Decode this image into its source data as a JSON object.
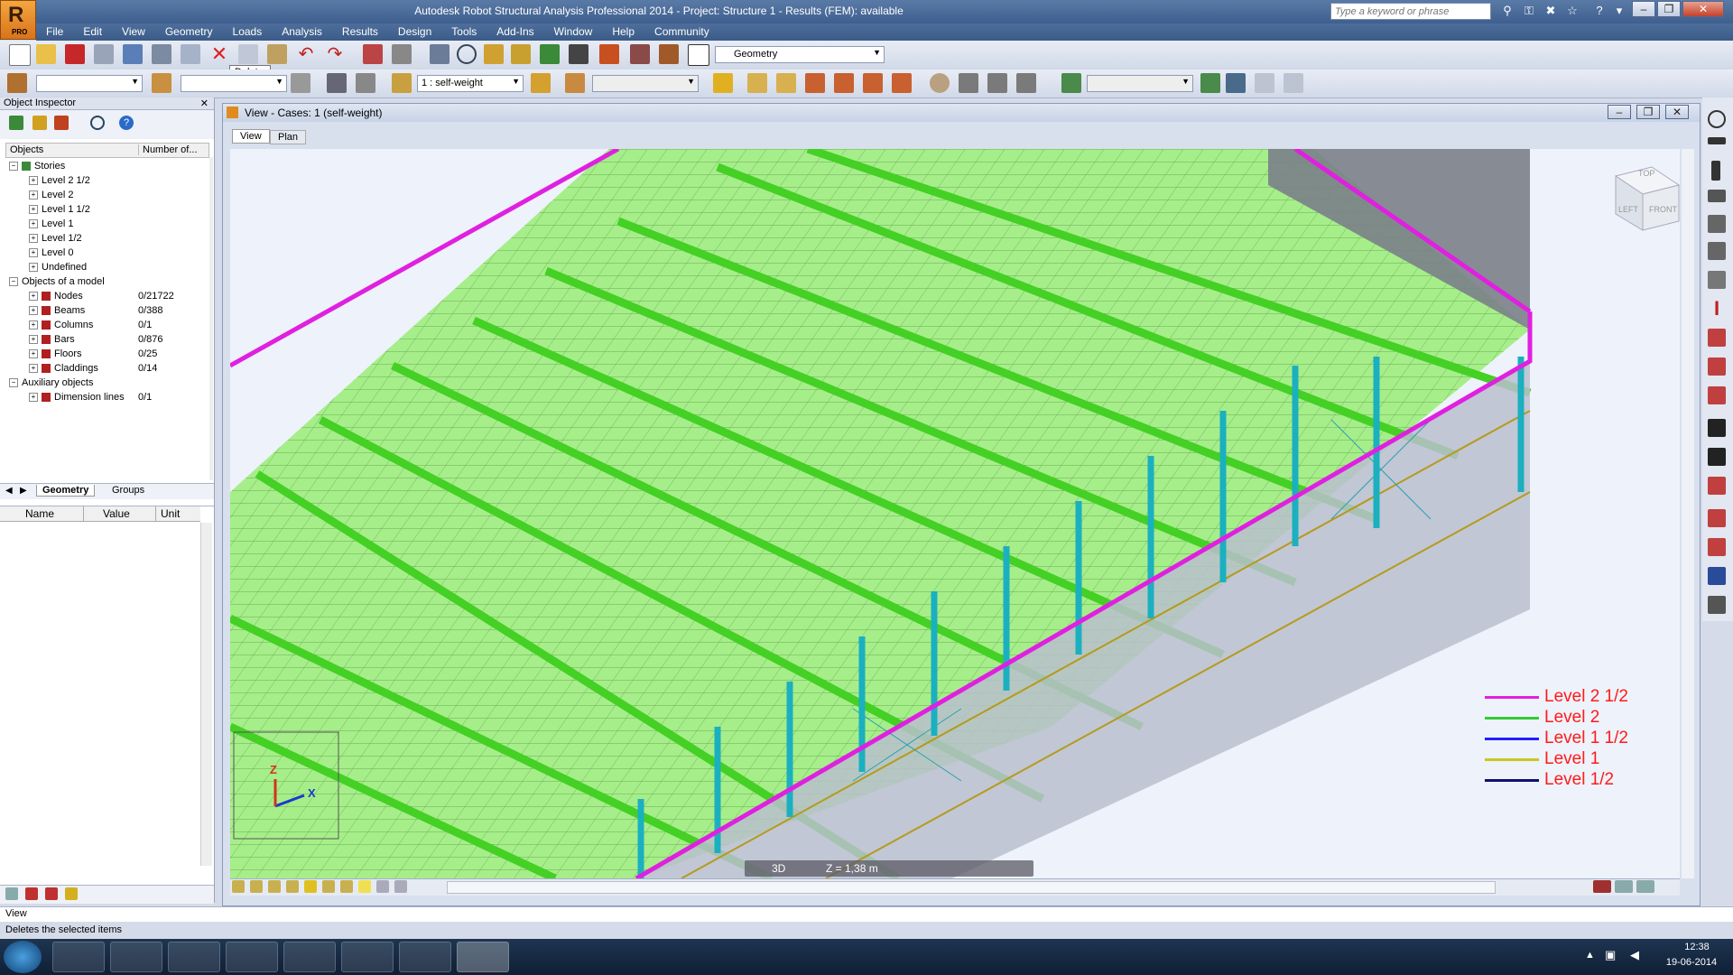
{
  "app": {
    "title": "Autodesk Robot Structural Analysis Professional 2014 - Project: Structure 1 - Results (FEM): available",
    "logo_letter": "R",
    "logo_badge": "PRO",
    "search_placeholder": "Type a keyword or phrase"
  },
  "menu": [
    "File",
    "Edit",
    "View",
    "Geometry",
    "Loads",
    "Analysis",
    "Results",
    "Design",
    "Tools",
    "Add-Ins",
    "Window",
    "Help",
    "Community"
  ],
  "toolbar": {
    "layout_combo": "Geometry",
    "case_combo": "1 : self-weight",
    "tooltip": "Delete"
  },
  "inspector": {
    "title": "Object Inspector",
    "col_objects": "Objects",
    "col_number": "Number of...",
    "tree": [
      {
        "label": "Stories",
        "count": "",
        "level": 0,
        "sign": "−",
        "icon": "stories-icon"
      },
      {
        "label": "Level 2 1/2",
        "count": "",
        "level": 1,
        "sign": "+",
        "icon": ""
      },
      {
        "label": "Level 2",
        "count": "",
        "level": 1,
        "sign": "+",
        "icon": ""
      },
      {
        "label": "Level 1 1/2",
        "count": "",
        "level": 1,
        "sign": "+",
        "icon": ""
      },
      {
        "label": "Level 1",
        "count": "",
        "level": 1,
        "sign": "+",
        "icon": ""
      },
      {
        "label": "Level 1/2",
        "count": "",
        "level": 1,
        "sign": "+",
        "icon": ""
      },
      {
        "label": "Level 0",
        "count": "",
        "level": 1,
        "sign": "+",
        "icon": ""
      },
      {
        "label": "Undefined",
        "count": "",
        "level": 1,
        "sign": "+",
        "icon": ""
      },
      {
        "label": "Objects of a model",
        "count": "",
        "level": 0,
        "sign": "−",
        "icon": ""
      },
      {
        "label": "Nodes",
        "count": "0/21722",
        "level": 1,
        "sign": "+",
        "icon": "node-icon"
      },
      {
        "label": "Beams",
        "count": "0/388",
        "level": 1,
        "sign": "+",
        "icon": "beam-icon"
      },
      {
        "label": "Columns",
        "count": "0/1",
        "level": 1,
        "sign": "+",
        "icon": "column-icon"
      },
      {
        "label": "Bars",
        "count": "0/876",
        "level": 1,
        "sign": "+",
        "icon": "bar-icon"
      },
      {
        "label": "Floors",
        "count": "0/25",
        "level": 1,
        "sign": "+",
        "icon": "floor-icon"
      },
      {
        "label": "Claddings",
        "count": "0/14",
        "level": 1,
        "sign": "+",
        "icon": "cladding-icon"
      },
      {
        "label": "Auxiliary objects",
        "count": "",
        "level": 0,
        "sign": "−",
        "icon": ""
      },
      {
        "label": "Dimension lines",
        "count": "0/1",
        "level": 1,
        "sign": "+",
        "icon": "dimension-icon"
      }
    ],
    "tab_geometry": "Geometry",
    "tab_groups": "Groups",
    "prop_name": "Name",
    "prop_value": "Value",
    "prop_unit": "Unit"
  },
  "view": {
    "title": "View - Cases: 1 (self-weight)",
    "tab_view": "View",
    "tab_plan": "Plan",
    "mode_3d": "3D",
    "z_level": "Z = 1,38 m",
    "cube_top": "TOP",
    "cube_left": "LEFT",
    "cube_front": "FRONT",
    "axis_x": "X",
    "axis_z": "Z",
    "legend": [
      {
        "label": "Level 2 1/2",
        "color": "#e020e0"
      },
      {
        "label": "Level 2",
        "color": "#33cc33"
      },
      {
        "label": "Level 1 1/2",
        "color": "#2020ff"
      },
      {
        "label": "Level 1",
        "color": "#c8c820"
      },
      {
        "label": "Level 1/2",
        "color": "#101070"
      }
    ]
  },
  "status": {
    "command": "View",
    "message": "Deletes the selected items"
  },
  "taskbar": {
    "time": "12:38",
    "date": "19-06-2014"
  }
}
